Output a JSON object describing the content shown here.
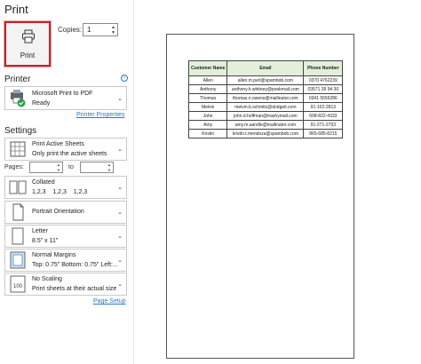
{
  "title": "Print",
  "print_button": {
    "label": "Print",
    "icon": "printer-icon"
  },
  "copies": {
    "label": "Copies:",
    "value": "1"
  },
  "printer": {
    "heading": "Printer",
    "name": "Microsoft Print to PDF",
    "status": "Ready",
    "properties_link": "Printer Properties"
  },
  "settings": {
    "heading": "Settings",
    "scope": {
      "title": "Print Active Sheets",
      "sub": "Only print the active sheets"
    },
    "pages": {
      "label": "Pages:",
      "to_label": "to",
      "from_value": "",
      "to_value": ""
    },
    "collation": {
      "title": "Collated",
      "sub": "1,2,3    1,2,3    1,2,3"
    },
    "orientation": {
      "title": "Portrait Orientation"
    },
    "paper": {
      "title": "Letter",
      "sub": "8.5\" x 11\""
    },
    "margins": {
      "title": "Normal Margins",
      "sub": "Top: 0.75\" Bottom: 0.75\" Left:..."
    },
    "scaling": {
      "title": "No Scaling",
      "sub": "Print sheets at their actual size"
    },
    "page_setup_link": "Page Setup"
  },
  "preview": {
    "headers": [
      "Customer Name",
      "Email",
      "Phone Number"
    ],
    "rows": [
      [
        "Allen",
        "allen.m.perl@spambob.com",
        "0370 4762239"
      ],
      [
        "Anthony",
        "anthony.h.whitney@pookmail.com",
        "03571 39 94 30"
      ],
      [
        "Thomas",
        "thomas.n.owens@mailinator.com",
        "0341 5556286"
      ],
      [
        "Melvin",
        "melvin.b.schmitz@dodgeit.com",
        "91-102-2813"
      ],
      [
        "John",
        "john.d.hoffman@trashymail.com",
        "608-822-4333"
      ],
      [
        "Amy",
        "amy.m.aandle@mailinator.com",
        "91-271-2703"
      ],
      [
        "Kristin",
        "kristin.t.mendoza@spambob.com",
        "865-685-8215"
      ]
    ]
  },
  "colors": {
    "accent_red": "#c0262d",
    "link_blue": "#2b78c2",
    "header_green": "#e2efda"
  }
}
